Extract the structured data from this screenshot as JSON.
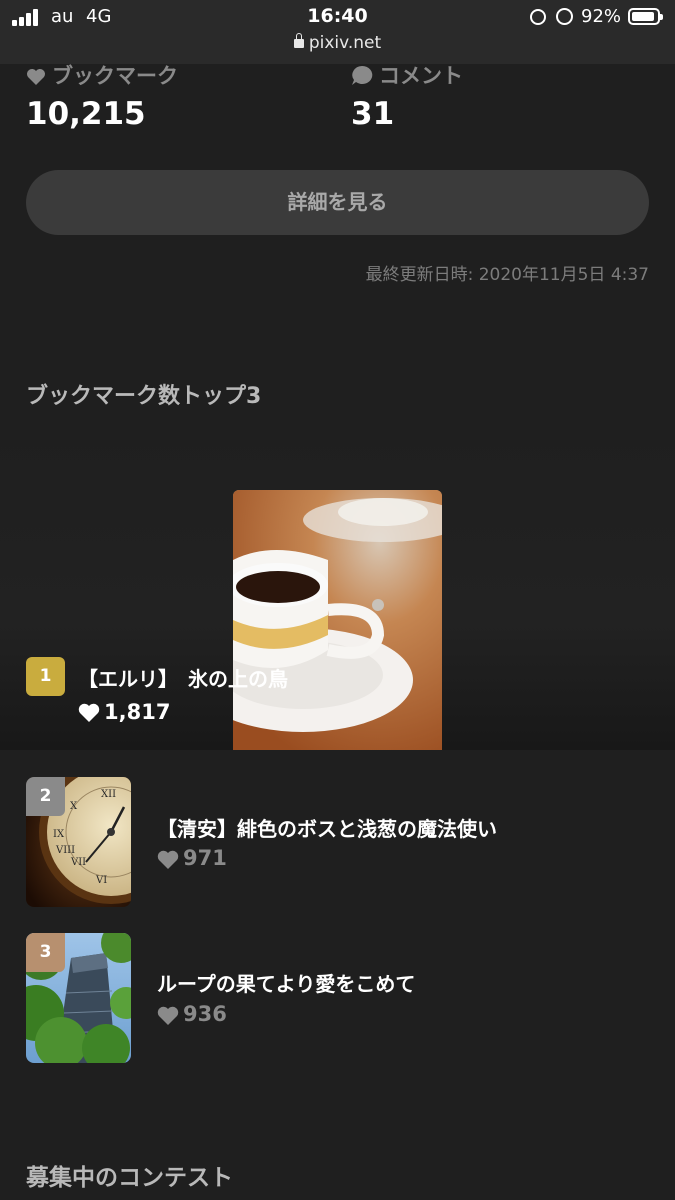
{
  "status_bar": {
    "carrier": "au",
    "network": "4G",
    "time": "16:40",
    "url": "pixiv.net",
    "battery_percent": "92%",
    "battery_level": 0.92
  },
  "stats": {
    "bookmark_label": "ブックマーク",
    "bookmark_value": "10,215",
    "comment_label": "コメント",
    "comment_value": "31"
  },
  "details_button_label": "詳細を見る",
  "last_updated": "最終更新日時: 2020年11月5日 4:37",
  "top3": {
    "title": "ブックマーク数トップ3",
    "items": [
      {
        "rank": "1",
        "title": "【エルリ】　氷の上の鳥",
        "bookmarks": "1,817"
      },
      {
        "rank": "2",
        "title": "【清安】緋色のボスと浅葱の魔法使い",
        "bookmarks": "971"
      },
      {
        "rank": "3",
        "title": "ループの果てより愛をこめて",
        "bookmarks": "936"
      }
    ]
  },
  "contests_title": "募集中のコンテスト",
  "colors": {
    "rank1": "#c9ac3e",
    "rank2": "#8a8a8a",
    "rank3": "#b7906f"
  }
}
